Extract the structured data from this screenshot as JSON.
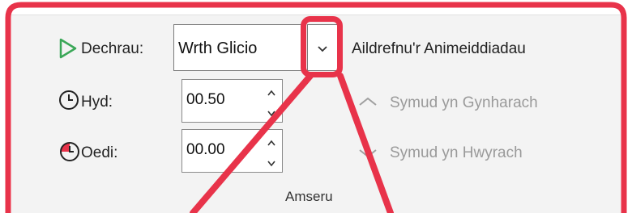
{
  "start": {
    "label": "Dechrau:",
    "value": "Wrth Glicio"
  },
  "duration": {
    "label": "Hyd:",
    "value": "00.50"
  },
  "delay": {
    "label": "Oedi:",
    "value": "00.00"
  },
  "reorder": {
    "title": "Aildrefnu'r Animeiddiadau",
    "move_earlier": "Symud yn Gynharach",
    "move_later": "Symud yn Hwyrach"
  },
  "group_label": "Amseru",
  "icons": {
    "start": "play-triangle-icon",
    "duration": "clock-icon",
    "delay": "clock-delay-icon",
    "dropdown": "chevron-down-icon",
    "earlier": "chevron-up-icon",
    "later": "chevron-down-icon"
  },
  "colors": {
    "highlight": "#e8334a",
    "play_green": "#3aa757",
    "ribbon_bg": "#f3f3f3"
  }
}
